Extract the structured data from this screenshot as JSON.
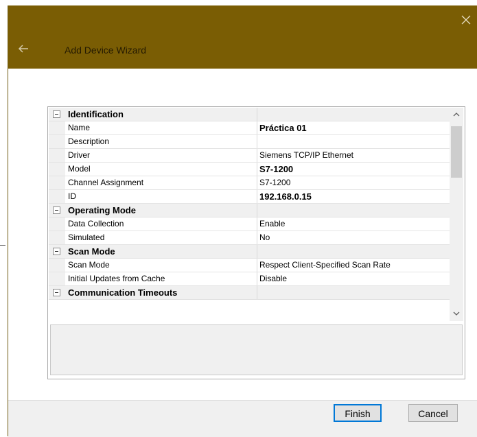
{
  "window": {
    "title": "Add Device Wizard",
    "back_icon": "back-arrow-icon",
    "close_icon": "close-icon",
    "titlebar_color": "#7a5d04"
  },
  "property_grid": {
    "categories": [
      {
        "label": "Identification",
        "rows": [
          {
            "name": "Name",
            "value": "Práctica 01",
            "bold": true
          },
          {
            "name": "Description",
            "value": "",
            "bold": false
          },
          {
            "name": "Driver",
            "value": "Siemens TCP/IP Ethernet",
            "bold": false
          },
          {
            "name": "Model",
            "value": "S7-1200",
            "bold": true
          },
          {
            "name": "Channel Assignment",
            "value": "S7-1200",
            "bold": false
          },
          {
            "name": "ID",
            "value": "192.168.0.15",
            "bold": true
          }
        ]
      },
      {
        "label": "Operating Mode",
        "rows": [
          {
            "name": "Data Collection",
            "value": "Enable",
            "bold": false
          },
          {
            "name": "Simulated",
            "value": "No",
            "bold": false
          }
        ]
      },
      {
        "label": "Scan Mode",
        "rows": [
          {
            "name": "Scan Mode",
            "value": "Respect Client-Specified Scan Rate",
            "bold": false
          },
          {
            "name": "Initial Updates from Cache",
            "value": "Disable",
            "bold": false
          }
        ]
      },
      {
        "label": "Communication Timeouts",
        "rows": []
      }
    ]
  },
  "buttons": {
    "finish": "Finish",
    "cancel": "Cancel"
  }
}
